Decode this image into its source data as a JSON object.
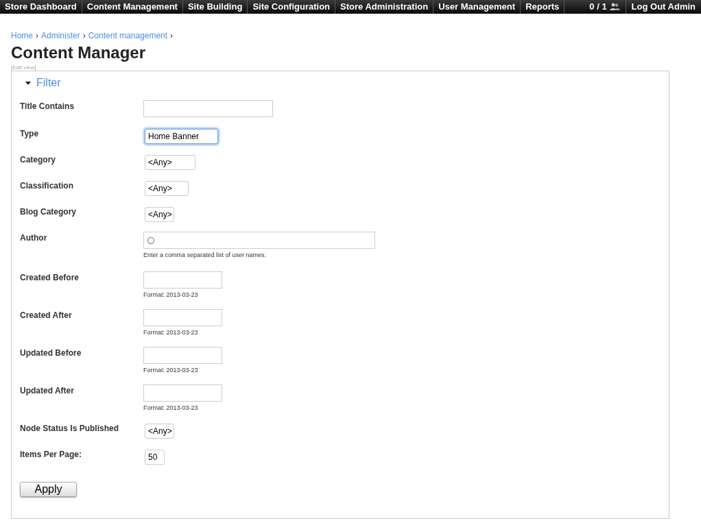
{
  "nav": {
    "items": [
      "Store Dashboard",
      "Content Management",
      "Site Building",
      "Site Configuration",
      "Store Administration",
      "User Management",
      "Reports"
    ],
    "users_count": "0 / 1",
    "logout": "Log Out Admin"
  },
  "breadcrumb": [
    "Home",
    "Administer",
    "Content management"
  ],
  "breadcrumb_separator": "›",
  "title": "Content Manager",
  "edit_view": "[Edit view]",
  "filter": {
    "legend": "Filter",
    "expanded": true,
    "fields": [
      {
        "kind": "text",
        "label": "Title Contains",
        "focused": false
      },
      {
        "kind": "select",
        "label": "Type",
        "value": "Home Banner",
        "focused": true
      },
      {
        "kind": "select",
        "label": "Category",
        "value": "<Any>",
        "focused": false
      },
      {
        "kind": "select",
        "label": "Classification",
        "value": "<Any>",
        "focused": false
      },
      {
        "kind": "select",
        "label": "Blog Category",
        "value": "<Any>",
        "focused": false
      },
      {
        "kind": "autocomplete",
        "label": "Author",
        "focused": false,
        "description": "Enter a comma separated list of user names."
      },
      {
        "kind": "text",
        "label": "Created Before",
        "focused": false,
        "description": "Format: 2013-03-23"
      },
      {
        "kind": "text",
        "label": "Created After",
        "focused": false,
        "description": "Format: 2013-03-23"
      },
      {
        "kind": "text",
        "label": "Updated Before",
        "focused": false,
        "description": "Format: 2013-03-23"
      },
      {
        "kind": "text",
        "label": "Updated After",
        "focused": false,
        "description": "Format: 2013-03-23"
      },
      {
        "kind": "select",
        "label": "Node Status Is Published",
        "value": "<Any>",
        "focused": false
      },
      {
        "kind": "select",
        "label": "Items Per Page:",
        "value": "50",
        "focused": false
      }
    ],
    "apply": "Apply"
  }
}
